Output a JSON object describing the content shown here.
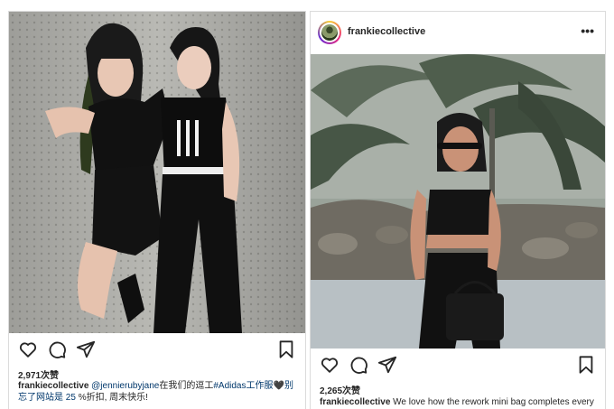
{
  "posts": [
    {
      "likes": "2,971次赞",
      "caption": {
        "username": "frankiecollective",
        "mention": "@jennierubyjane",
        "text_a": "在我们的逗工",
        "hashtag": "#Adidas",
        "hashtag_tail": "工作服",
        "heart": "🖤",
        "link_start": "别",
        "line2_link": "忘了网站是",
        "discount": "25",
        "text_b": "%折扣, 周末快乐!"
      }
    },
    {
      "header": {
        "username": "frankiecollective"
      },
      "likes": "2,265次赞",
      "caption": {
        "username": "frankiecollective",
        "text": "We love how the rework mini bag completes every"
      }
    }
  ],
  "icons": {
    "like": "heart-icon",
    "comment": "comment-icon",
    "share": "share-icon",
    "save": "bookmark-icon",
    "more": "more-options-icon"
  },
  "colors": {
    "link": "#00376b",
    "text": "#262626",
    "border": "#dbdbdb"
  }
}
